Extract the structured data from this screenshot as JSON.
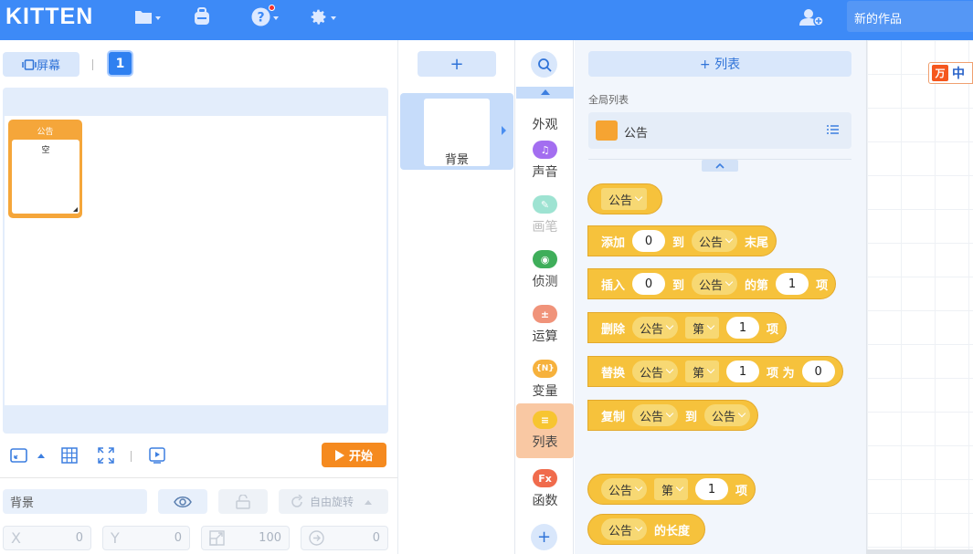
{
  "app": {
    "logo": "KITTEN",
    "project_title": "新的作品"
  },
  "stage_panel": {
    "screen_label": "屏幕",
    "page_number": "1",
    "list_widget_title": "公告",
    "list_widget_content": "空",
    "start_label": "开始",
    "sprite_name": "背景",
    "rotate_label": "自由旋转",
    "x_label": "X",
    "x_value": "0",
    "y_label": "Y",
    "y_value": "0",
    "scale_value": "100",
    "angle_value": "0"
  },
  "sprites": {
    "add_label": "+",
    "items": [
      {
        "name": "背景"
      }
    ]
  },
  "categories": [
    {
      "label": "外观",
      "color": "#f57ab6",
      "icon": ""
    },
    {
      "label": "声音",
      "color": "#a36ef0",
      "icon": "♫"
    },
    {
      "label": "画笔",
      "color": "#9ee3d2",
      "icon": "✎"
    },
    {
      "label": "侦测",
      "color": "#3fae5a",
      "icon": "◉"
    },
    {
      "label": "运算",
      "color": "#f0937a",
      "icon": "±"
    },
    {
      "label": "变量",
      "color": "#f6b13c",
      "icon": "{N}"
    },
    {
      "label": "列表",
      "color": "#f7c531",
      "icon": "≡"
    },
    {
      "label": "函数",
      "color": "#f06b4c",
      "icon": "Fx"
    }
  ],
  "palette": {
    "add_list_label": "+ 列表",
    "section_label": "全局列表",
    "list_name": "公告",
    "blocks": {
      "reporter_list": "公告",
      "add": {
        "verb": "添加",
        "value": "0",
        "to": "到",
        "list": "公告",
        "tail": "末尾"
      },
      "insert": {
        "verb": "插入",
        "value": "0",
        "to": "到",
        "list": "公告",
        "mid": "的第",
        "index": "1",
        "tail": "项"
      },
      "delete": {
        "verb": "删除",
        "list": "公告",
        "mode": "第",
        "index": "1",
        "tail": "项"
      },
      "replace": {
        "verb": "替换",
        "list": "公告",
        "mode": "第",
        "index": "1",
        "mid": "项 为",
        "value": "0"
      },
      "copy": {
        "verb": "复制",
        "list": "公告",
        "to": "到",
        "target": "公告"
      },
      "item": {
        "list": "公告",
        "mode": "第",
        "index": "1",
        "tail": "项"
      },
      "length": {
        "list": "公告",
        "tail": "的长度"
      }
    }
  },
  "ime": {
    "text": "中"
  }
}
